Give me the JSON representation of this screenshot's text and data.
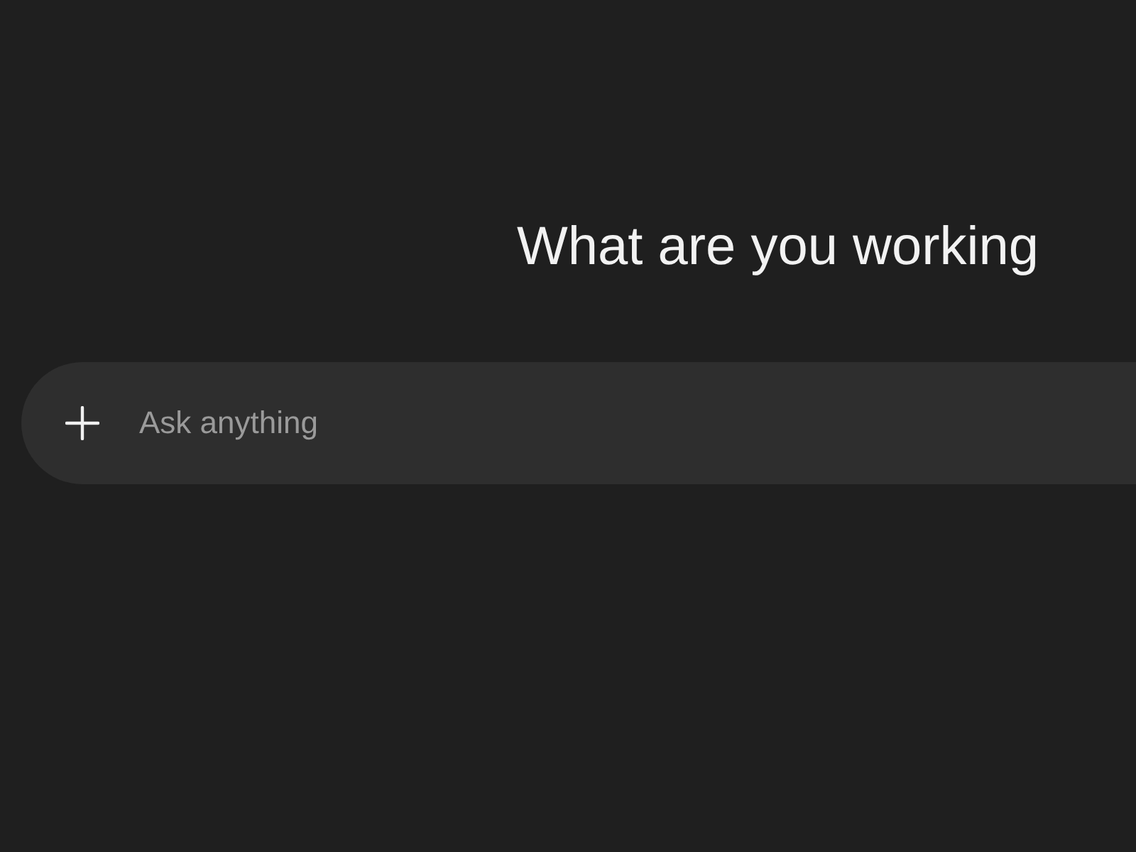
{
  "heading": "What are you working",
  "composer": {
    "placeholder": "Ask anything"
  }
}
